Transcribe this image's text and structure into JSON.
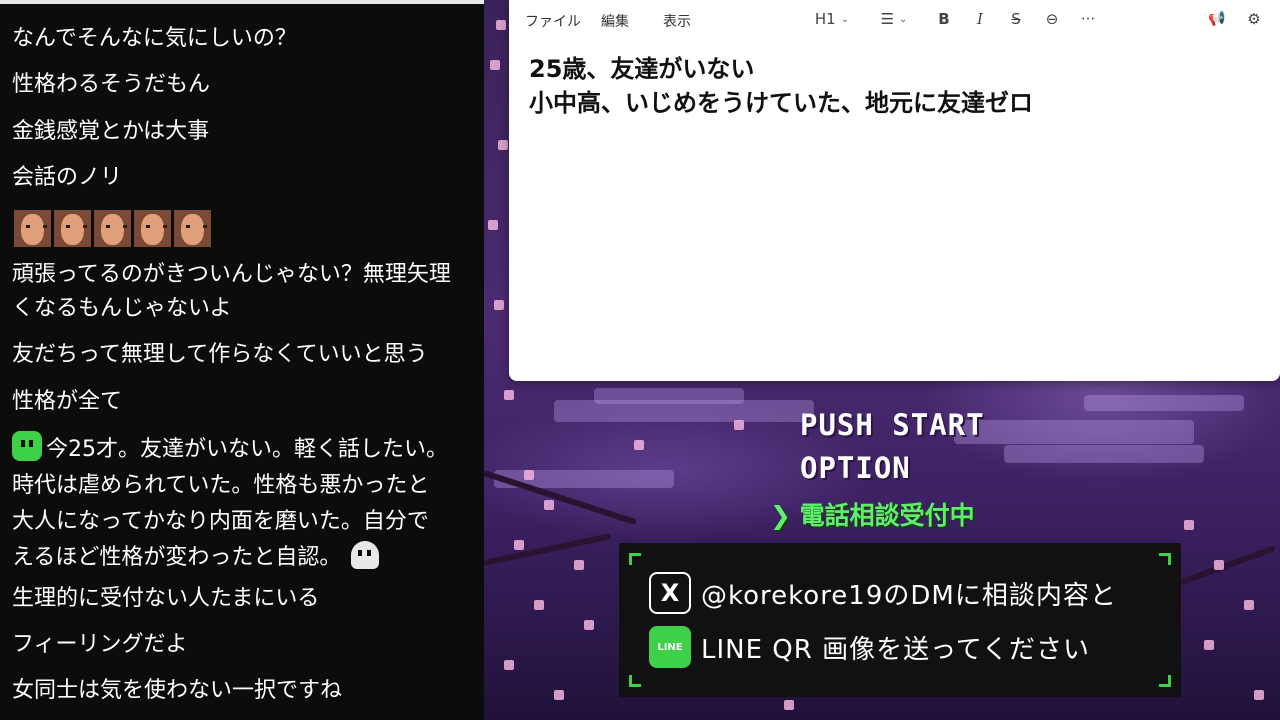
{
  "chat": {
    "messages": [
      {
        "text": "なんでそんなに気にしいの？"
      },
      {
        "text": "性格わるそうだもん"
      },
      {
        "text": "金銭感覚とかは大事"
      },
      {
        "text": "会話のノリ"
      },
      {
        "line1": "頑張ってるのがきついんじゃない？無理矢理",
        "line2": "くなるもんじゃないよ"
      },
      {
        "text": "友だちって無理して作らなくていいと思う"
      },
      {
        "text": "性格が全て"
      },
      {
        "line1": "今25才。友達がいない。軽く話したい。",
        "line2": "時代は虐められていた。性格も悪かったと",
        "line3": "大人になってかなり内面を磨いた。自分で",
        "line4": "えるほど性格が変わったと自認。"
      },
      {
        "text": "生理的に受付ない人たまにいる"
      },
      {
        "text": "フィーリングだよ"
      },
      {
        "text": "女同士は気を使わない一択ですね"
      }
    ],
    "face_emote_count": 5,
    "emote_names": [
      "face-emote",
      "green-emote",
      "ghost-emote"
    ]
  },
  "notes": {
    "menu": [
      "ファイル",
      "編集",
      "表示"
    ],
    "toolbar": {
      "heading": "H1",
      "bold": "B",
      "italic": "I",
      "strike": "S",
      "link_icon": "⊖",
      "more": "···",
      "list_icon": "☰",
      "announce_icon": "📢",
      "settings_icon": "⚙"
    },
    "lines": [
      "25歳、友達がいない",
      "小中高、いじめをうけていた、地元に友達ゼロ"
    ]
  },
  "overlay": {
    "push_start": "PUSH START",
    "option": "OPTION",
    "phone_label": "電話相談受付中",
    "cursor": "❯"
  },
  "contact": {
    "x_icon": "X",
    "x_text": "@korekore19のDMに相談内容と",
    "line_icon": "LINE",
    "line_text": "LINE QR 画像を送ってください"
  },
  "colors": {
    "accent_green": "#3ed048",
    "chat_bg": "#0c0c0c",
    "scene_purple": "#4b2a72"
  }
}
